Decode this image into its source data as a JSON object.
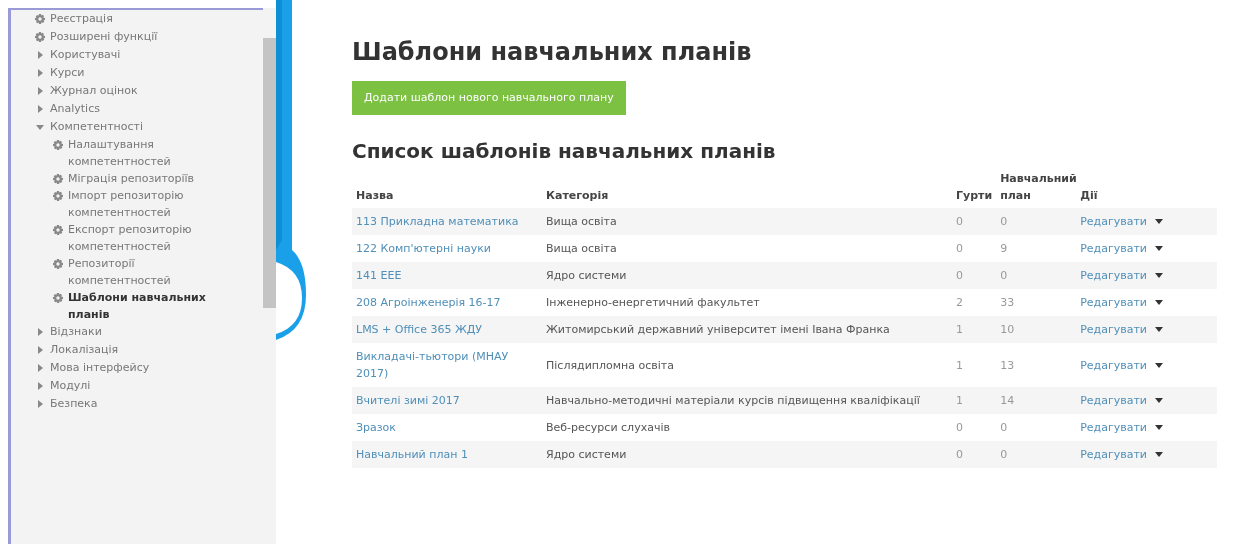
{
  "sidebar": {
    "items": [
      {
        "label": "Реєстрація",
        "kind": "gear",
        "selected": false
      },
      {
        "label": "Розширені функції",
        "kind": "gear",
        "selected": false
      },
      {
        "label": "Користувачі",
        "kind": "folder",
        "expanded": false,
        "selected": false
      },
      {
        "label": "Курси",
        "kind": "folder",
        "expanded": false,
        "selected": false
      },
      {
        "label": "Журнал оцінок",
        "kind": "folder",
        "expanded": false,
        "selected": false
      },
      {
        "label": "Analytics",
        "kind": "folder",
        "expanded": false,
        "selected": false
      },
      {
        "label": "Компетентності",
        "kind": "folder",
        "expanded": true,
        "selected": false,
        "children": [
          {
            "label": "Налаштування компетентностей",
            "kind": "gear",
            "selected": false
          },
          {
            "label": "Міграція репозиторіїв",
            "kind": "gear",
            "selected": false
          },
          {
            "label": "Імпорт репозиторію компетентностей",
            "kind": "gear",
            "selected": false
          },
          {
            "label": "Експорт репозиторію компетентностей",
            "kind": "gear",
            "selected": false
          },
          {
            "label": "Репозиторії компетентностей",
            "kind": "gear",
            "selected": false
          },
          {
            "label": "Шаблони навчальних планів",
            "kind": "gear",
            "selected": true
          }
        ]
      },
      {
        "label": "Відзнаки",
        "kind": "folder",
        "expanded": false,
        "selected": false
      },
      {
        "label": "Локалізація",
        "kind": "folder",
        "expanded": false,
        "selected": false
      },
      {
        "label": "Мова інтерфейсу",
        "kind": "folder",
        "expanded": false,
        "selected": false
      },
      {
        "label": "Модулі",
        "kind": "folder",
        "expanded": false,
        "selected": false
      },
      {
        "label": "Безпека",
        "kind": "folder",
        "expanded": false,
        "selected": false
      }
    ]
  },
  "page_title": "Шаблони навчальних планів",
  "add_button": "Додати шаблон нового навчального плану",
  "list_title": "Список шаблонів навчальних планів",
  "table": {
    "columns": [
      "Назва",
      "Категорія",
      "Гурти",
      "Навчальний план",
      "Дії"
    ],
    "rows": [
      {
        "name": "113 Прикладна математика",
        "category": "Вища освіта",
        "cohorts": "0",
        "plans": "0",
        "action": "Редагувати"
      },
      {
        "name": "122 Комп'ютерні науки",
        "category": "Вища освіта",
        "cohorts": "0",
        "plans": "9",
        "action": "Редагувати"
      },
      {
        "name": "141 EEE",
        "category": "Ядро системи",
        "cohorts": "0",
        "plans": "0",
        "action": "Редагувати"
      },
      {
        "name": "208 Агроінженерія 16-17",
        "category": "Інженерно-енергетичний факультет",
        "cohorts": "2",
        "plans": "33",
        "action": "Редагувати"
      },
      {
        "name": "LMS + Office 365 ЖДУ",
        "category": "Житомирський державний університет імені Івана Франка",
        "cohorts": "1",
        "plans": "10",
        "action": "Редагувати"
      },
      {
        "name": "Викладачі-тьютори (МНАУ 2017)",
        "category": "Післядипломна освіта",
        "cohorts": "1",
        "plans": "13",
        "action": "Редагувати"
      },
      {
        "name": "Вчителі зимі 2017",
        "category": "Навчально-методичні матеріали курсів підвищення кваліфікації",
        "cohorts": "1",
        "plans": "14",
        "action": "Редагувати"
      },
      {
        "name": "Зразок",
        "category": "Веб-ресурси слухачів",
        "cohorts": "0",
        "plans": "0",
        "action": "Редагувати"
      },
      {
        "name": "Навчальний план 1",
        "category": "Ядро системи",
        "cohorts": "0",
        "plans": "0",
        "action": "Редагувати"
      }
    ]
  }
}
